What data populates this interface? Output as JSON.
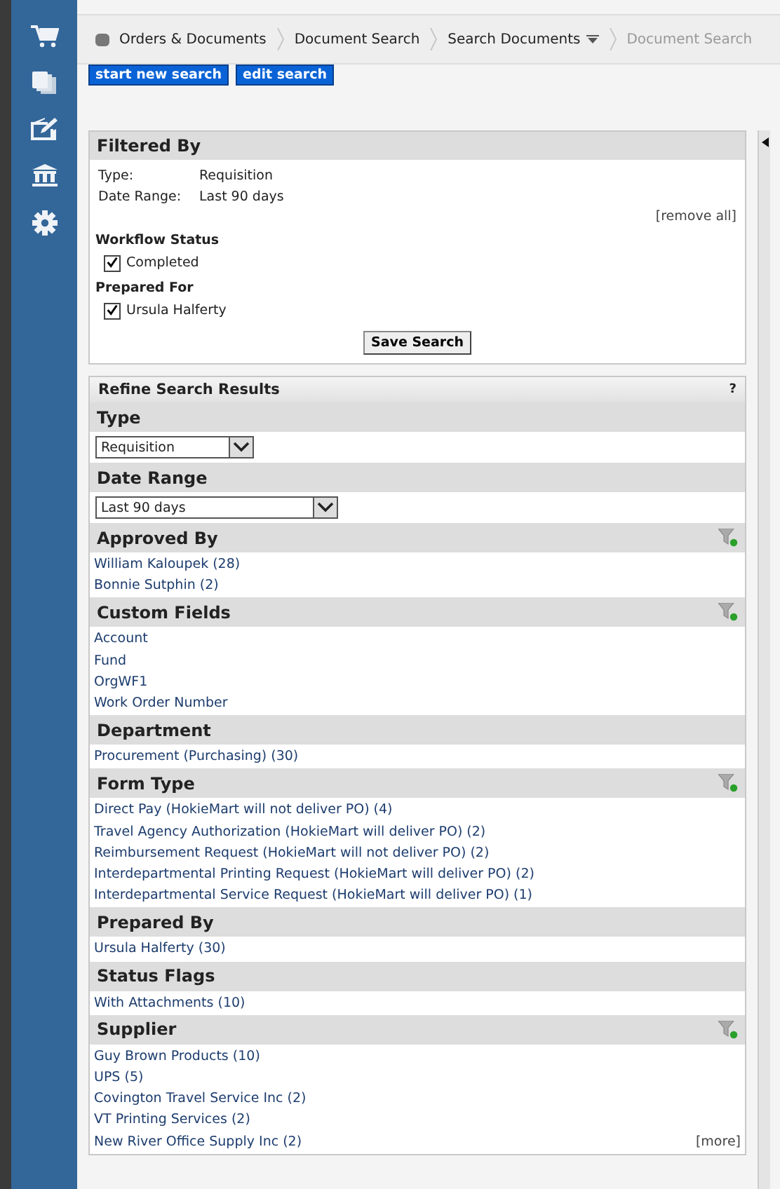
{
  "breadcrumb": [
    {
      "label": "Orders & Documents",
      "current": false,
      "dropdown": false
    },
    {
      "label": "Document Search",
      "current": false,
      "dropdown": false
    },
    {
      "label": "Search Documents",
      "current": false,
      "dropdown": true
    },
    {
      "label": "Document Search",
      "current": true,
      "dropdown": false
    }
  ],
  "actions": [
    "start new search",
    "edit search"
  ],
  "filtered_by": {
    "title": "Filtered By",
    "criteria": [
      {
        "label": "Type:",
        "value": "Requisition"
      },
      {
        "label": "Date Range:",
        "value": "Last 90 days"
      }
    ],
    "remove_all": "[remove all]",
    "groups": [
      {
        "title": "Workflow Status",
        "options": [
          {
            "label": "Completed",
            "checked": true
          }
        ]
      },
      {
        "title": "Prepared For",
        "options": [
          {
            "label": "Ursula Halferty",
            "checked": true
          }
        ]
      }
    ],
    "save_button": "Save Search"
  },
  "refine": {
    "title": "Refine Search Results",
    "help": "?",
    "sections": [
      {
        "title": "Type",
        "kind": "select",
        "value": "Requisition",
        "wide": false,
        "filter": false
      },
      {
        "title": "Date Range",
        "kind": "select",
        "value": "Last 90 days",
        "wide": true,
        "filter": false
      },
      {
        "title": "Approved By",
        "kind": "list",
        "filter": true,
        "items": [
          "William Kaloupek (28)",
          "Bonnie Sutphin (2)"
        ]
      },
      {
        "title": "Custom Fields",
        "kind": "list",
        "filter": true,
        "items": [
          "Account",
          "Fund",
          "OrgWF1",
          "Work Order Number"
        ]
      },
      {
        "title": "Department",
        "kind": "list",
        "filter": false,
        "items": [
          "Procurement (Purchasing) (30)"
        ]
      },
      {
        "title": "Form Type",
        "kind": "list",
        "filter": true,
        "items": [
          "Direct Pay (HokieMart will not deliver PO) (4)",
          "Travel Agency Authorization (HokieMart will deliver PO) (2)",
          "Reimbursement Request (HokieMart will not deliver PO) (2)",
          "Interdepartmental Printing Request (HokieMart will deliver PO) (2)",
          "Interdepartmental Service Request (HokieMart will deliver PO) (1)"
        ]
      },
      {
        "title": "Prepared By",
        "kind": "list",
        "filter": false,
        "items": [
          "Ursula Halferty (30)"
        ]
      },
      {
        "title": "Status Flags",
        "kind": "list",
        "filter": false,
        "items": [
          "With Attachments (10)"
        ]
      },
      {
        "title": "Supplier",
        "kind": "list",
        "filter": true,
        "items": [
          "Guy Brown Products (10)",
          "UPS (5)",
          "Covington Travel Service Inc (2)",
          "VT Printing Services (2)",
          "New River Office Supply Inc (2)"
        ],
        "more": "[more]"
      }
    ]
  }
}
